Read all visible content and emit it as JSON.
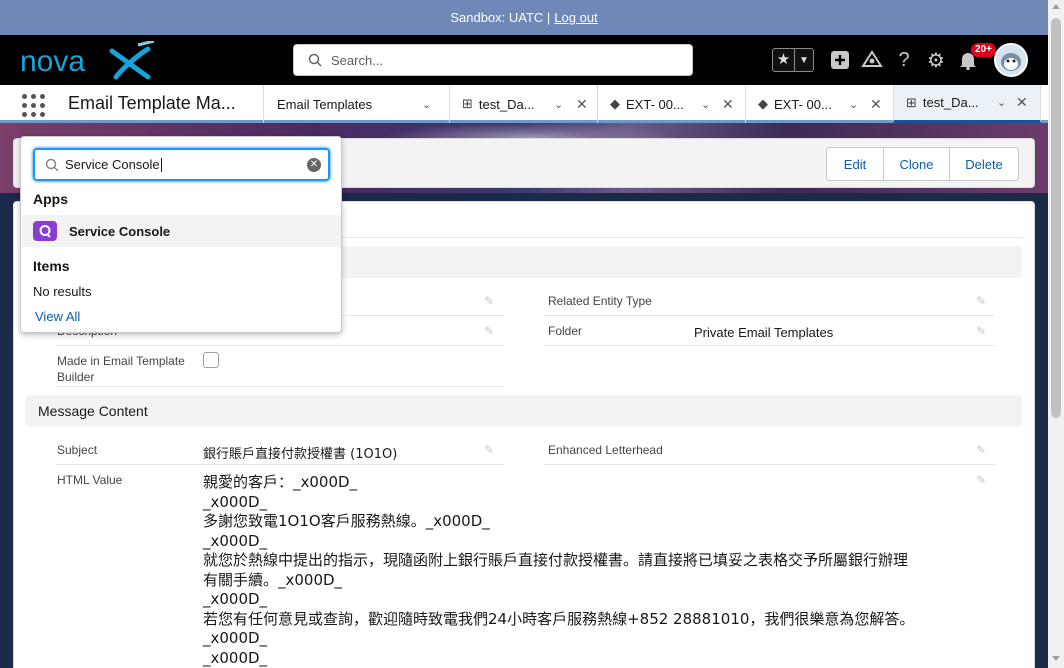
{
  "sandbox": {
    "text": "Sandbox: UATC |",
    "logout": "Log out"
  },
  "header": {
    "search_placeholder": "Search...",
    "notif_count": "20+"
  },
  "nav": {
    "app_name": "Email Template Ma...",
    "tabs": [
      {
        "label": "Email Templates",
        "icon": "none"
      },
      {
        "label": "test_Da...",
        "icon": "template-icon"
      },
      {
        "label": "EXT- 00...",
        "icon": "diamond-icon"
      },
      {
        "label": "EXT- 00...",
        "icon": "diamond-icon"
      },
      {
        "label": "test_Da...",
        "icon": "template-icon",
        "active": true
      }
    ]
  },
  "actions": {
    "edit": "Edit",
    "clone": "Clone",
    "delete": "Delete"
  },
  "dropdown": {
    "query": "Service Console",
    "apps_heading": "Apps",
    "app_result": "Service Console",
    "items_heading": "Items",
    "no_results": "No results",
    "view_all": "View All"
  },
  "details": {
    "desc_label_partial": "Description",
    "made_in_label": "Made in Email Template Builder",
    "related_entity_label": "Related Entity Type",
    "folder_label": "Folder",
    "folder_value": "Private Email Templates"
  },
  "message": {
    "section_title": "Message Content",
    "subject_label": "Subject",
    "subject_value": "銀行賬戶直接付款授權書 (1O1O)",
    "letterhead_label": "Enhanced Letterhead",
    "html_label": "HTML Value",
    "html_lines": [
      "親愛的客戶：_x000D_",
      "_x000D_",
      "多謝您致電1O1O客戶服務熱線。_x000D_",
      "_x000D_",
      "就您於熱線中提出的指示，現隨函附上銀行賬戶直接付款授權書。請直接將已填妥之表格交予所屬銀行辦理",
      "有關手續。_x000D_",
      "_x000D_",
      "若您有任何意見或查詢，歡迎隨時致電我們24小時客戶服務熱線+852 28881010，我們很樂意為您解答。",
      "_x000D_",
      "_x000D_"
    ]
  },
  "colors": {
    "brand_blue": "#1b96ff",
    "link": "#0b5cab",
    "header_bg": "#000000",
    "sandbox_bg": "#6f88b8",
    "badge": "#e3001a"
  }
}
